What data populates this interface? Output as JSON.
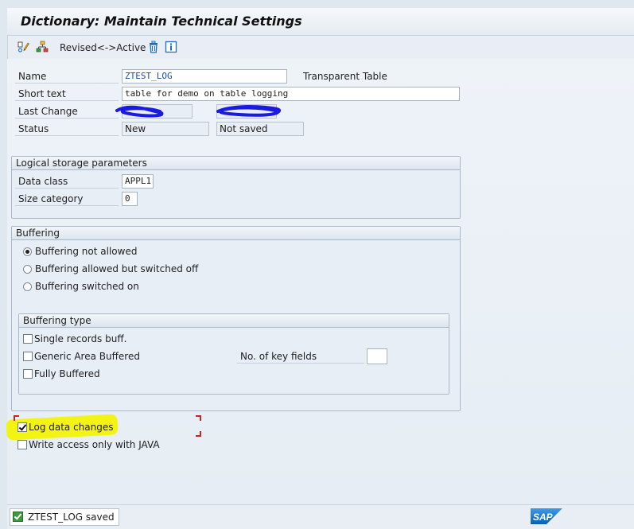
{
  "window": {
    "title": "Dictionary: Maintain Technical Settings"
  },
  "toolbar": {
    "revised_active_label": "Revised<->Active",
    "icons": [
      "display-change-icon",
      "hierarchy-icon",
      "delete-icon",
      "info-icon"
    ]
  },
  "header": {
    "name_label": "Name",
    "name_value": "ZTEST_LOG",
    "table_type": "Transparent Table",
    "short_text_label": "Short text",
    "short_text_value": "table for demo on table logging",
    "last_change_label": "Last Change",
    "status_label": "Status",
    "status_value": "New",
    "save_status_value": "Not saved"
  },
  "logical_storage": {
    "title": "Logical storage parameters",
    "data_class_label": "Data class",
    "data_class_value": "APPL1",
    "size_category_label": "Size category",
    "size_category_value": "0"
  },
  "buffering": {
    "title": "Buffering",
    "options": [
      {
        "label": "Buffering not allowed",
        "selected": true
      },
      {
        "label": "Buffering allowed but switched off",
        "selected": false
      },
      {
        "label": "Buffering switched on",
        "selected": false
      }
    ],
    "type": {
      "title": "Buffering type",
      "single_label": "Single records buff.",
      "generic_label": "Generic Area Buffered",
      "fully_label": "Fully Buffered",
      "key_fields_label": "No. of key fields",
      "key_fields_value": ""
    }
  },
  "options": {
    "log_data_changes_label": "Log data changes",
    "log_data_changes_checked": true,
    "write_access_java_label": "Write access only with JAVA",
    "write_access_java_checked": false
  },
  "status_bar": {
    "message": "ZTEST_LOG saved",
    "logo_text": "SAP"
  },
  "colors": {
    "accent_blue": "#1a6fc4",
    "highlight_yellow": "#f4f414",
    "marker_red": "#d02020",
    "ok_green": "#3c9a3c"
  }
}
